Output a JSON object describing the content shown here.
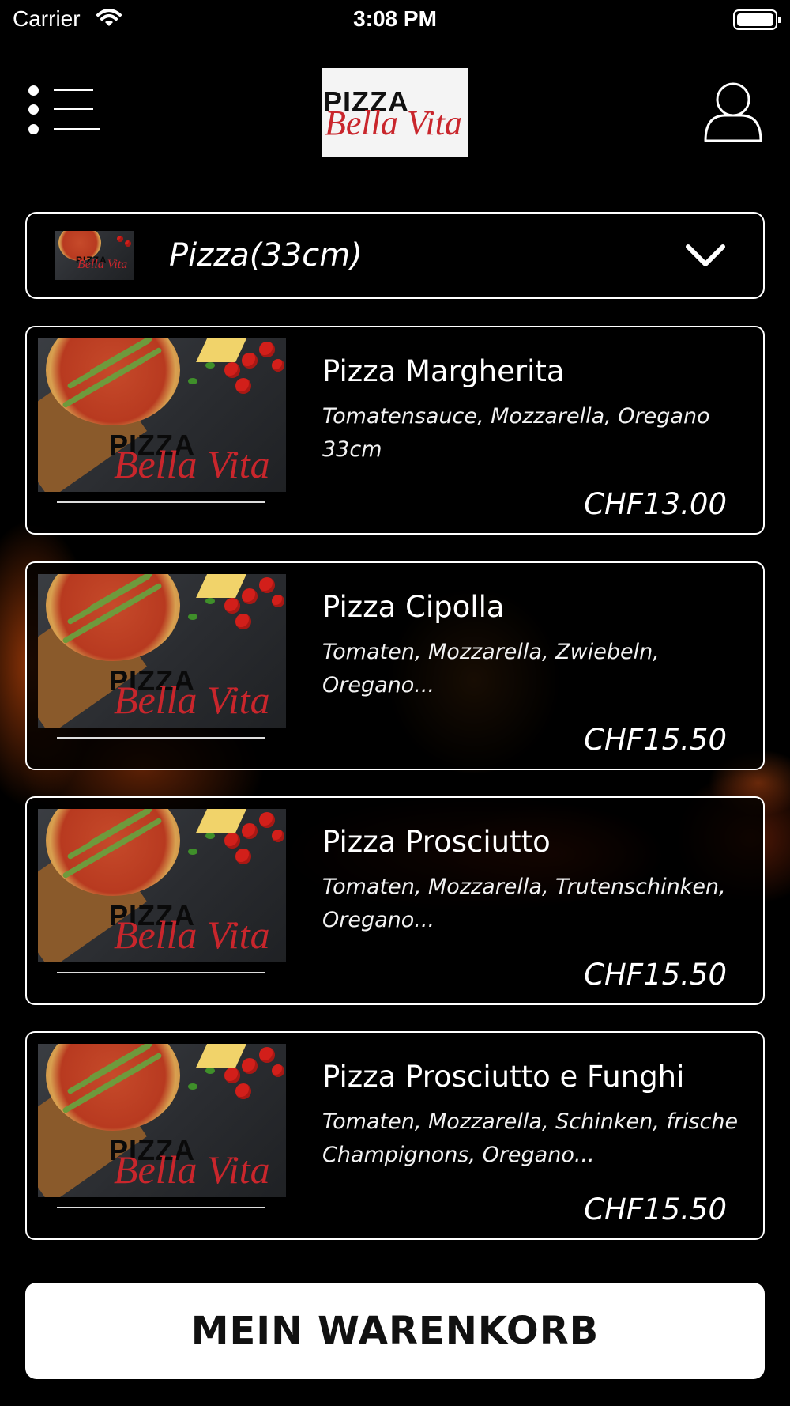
{
  "status_bar": {
    "carrier": "Carrier",
    "time": "3:08 PM",
    "battery_level": 1.0
  },
  "header": {
    "logo": {
      "top_text": "PIZZA",
      "script_text": "Bella Vita"
    }
  },
  "category": {
    "label": "Pizza(33cm)"
  },
  "products": [
    {
      "name": "Pizza Margherita",
      "description": "Tomatensauce, Mozzarella, Oregano 33cm",
      "price": "CHF13.00"
    },
    {
      "name": "Pizza Cipolla",
      "description": "Tomaten, Mozzarella, Zwiebeln, Oregano...",
      "price": "CHF15.50"
    },
    {
      "name": "Pizza Prosciutto",
      "description": "Tomaten, Mozzarella, Trutenschinken, Oregano...",
      "price": "CHF15.50"
    },
    {
      "name": "Pizza Prosciutto e Funghi",
      "description": "Tomaten, Mozzarella, Schinken, frische Champignons, Oregano...",
      "price": "CHF15.50"
    }
  ],
  "cart": {
    "label": "MEIN WARENKORB"
  },
  "colors": {
    "background": "#000000",
    "accent_red": "#c9262c",
    "card_border": "#ffffff",
    "button_bg": "#ffffff"
  },
  "icons": {
    "menu": "menu-icon",
    "user": "user-icon",
    "chevron": "chevron-down-icon",
    "wifi": "wifi-icon",
    "battery": "battery-icon"
  }
}
